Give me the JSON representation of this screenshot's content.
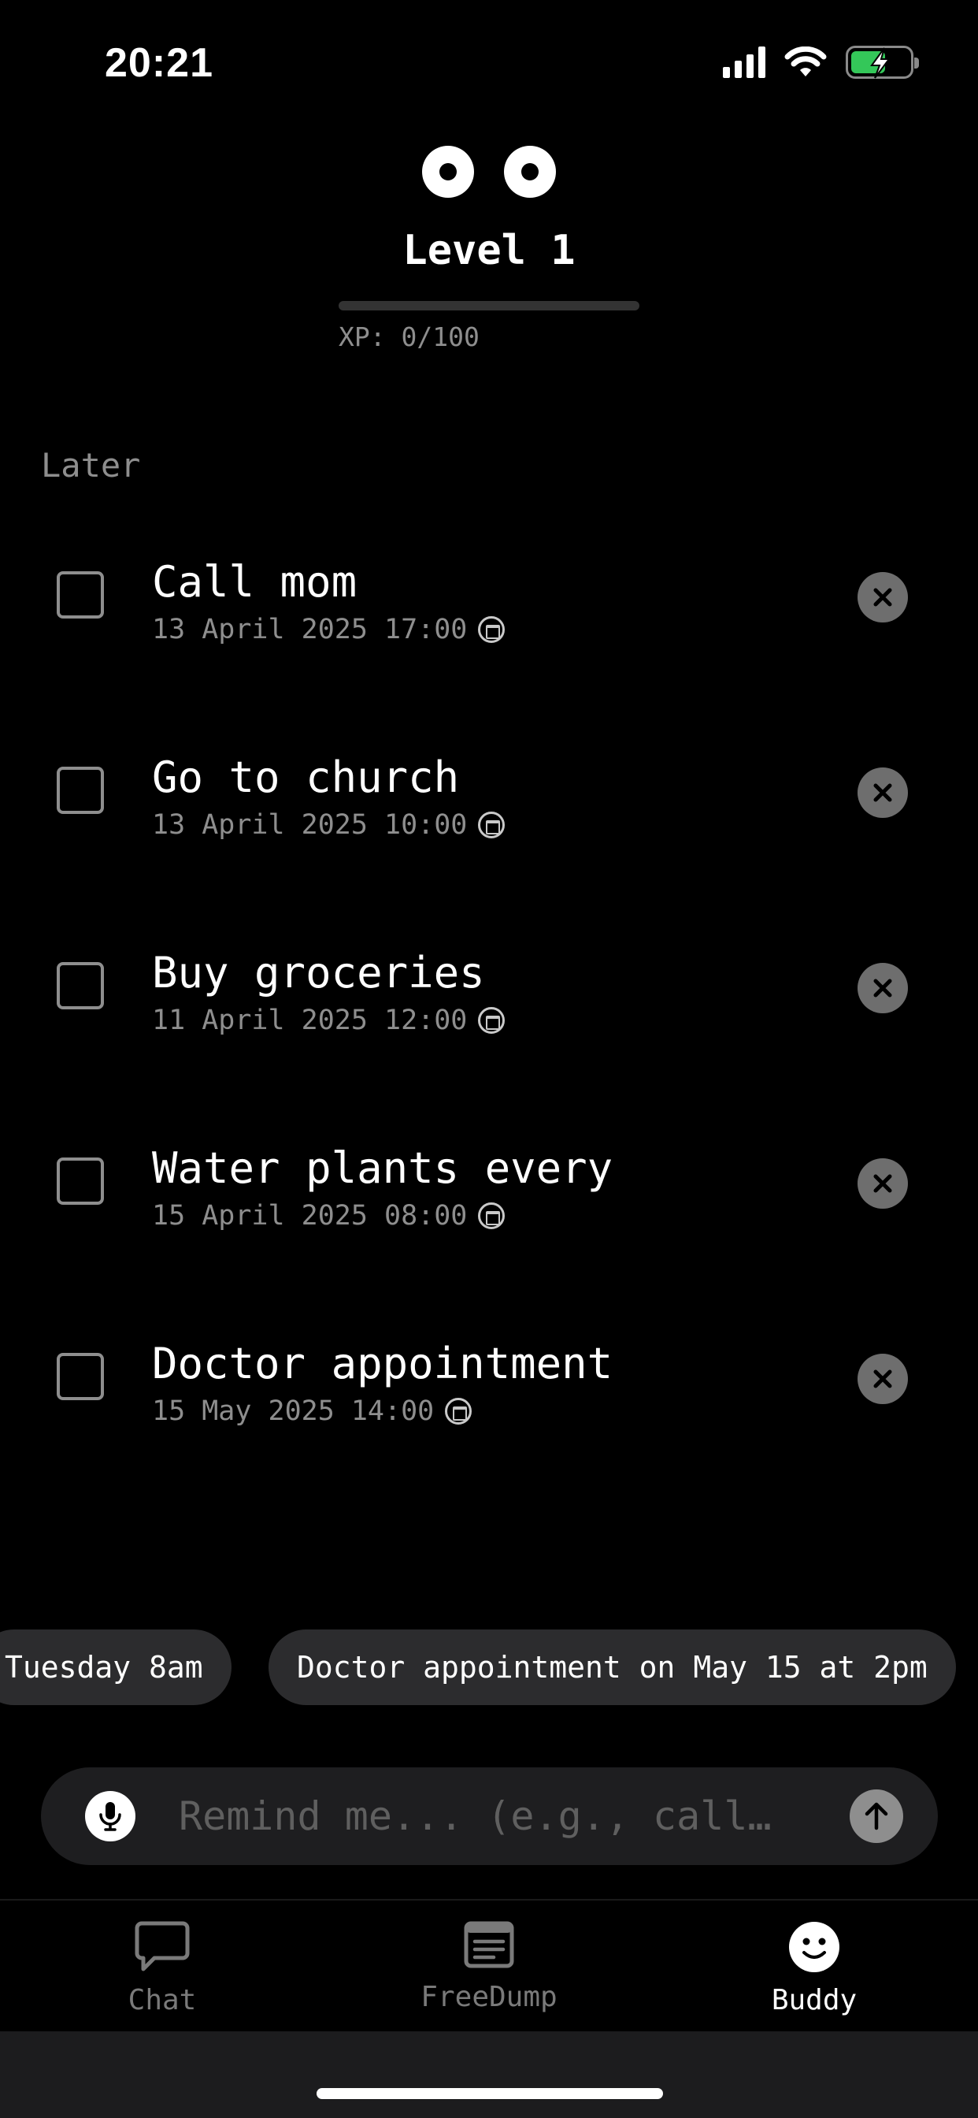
{
  "status_bar": {
    "time": "20:21",
    "icons": [
      "signal-icon",
      "wifi-icon",
      "battery-charging-icon"
    ],
    "battery_color": "#34c759"
  },
  "buddy": {
    "level_title": "Level 1",
    "xp_label": "XP: 0/100",
    "xp_progress": 0.0
  },
  "section": {
    "label": "Later"
  },
  "tasks": [
    {
      "title": "Call mom",
      "date": "13 April 2025 17:00",
      "done": false
    },
    {
      "title": "Go to church",
      "date": "13 April 2025 10:00",
      "done": false
    },
    {
      "title": "Buy groceries",
      "date": "11 April 2025 12:00",
      "done": false
    },
    {
      "title": "Water plants every",
      "date": "15 April 2025 08:00",
      "done": false
    },
    {
      "title": "Doctor appointment",
      "date": "15 May 2025 14:00",
      "done": false
    }
  ],
  "suggestions": [
    "Tuesday 8am",
    "Doctor appointment on May 15 at 2pm"
  ],
  "input": {
    "placeholder": "Remind me... (e.g., call…",
    "value": ""
  },
  "tabs": [
    {
      "label": "Chat",
      "icon": "chat-bubble-icon",
      "active": false
    },
    {
      "label": "FreeDump",
      "icon": "notes-icon",
      "active": false
    },
    {
      "label": "Buddy",
      "icon": "smiley-icon",
      "active": true
    }
  ]
}
